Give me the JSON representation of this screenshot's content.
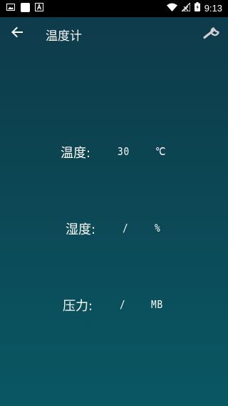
{
  "status_bar": {
    "time": "9:13",
    "left_icons": [
      "image-icon",
      "square-icon",
      "a-icon"
    ],
    "right_icons": [
      "wifi-icon",
      "signal-icon",
      "battery-icon"
    ]
  },
  "app_bar": {
    "title": "温度计",
    "back_icon": "arrow-left-icon",
    "settings_icon": "wrench-icon"
  },
  "readings": [
    {
      "label": "温度:",
      "value": "30",
      "unit": "℃"
    },
    {
      "label": "湿度:",
      "value": "/",
      "unit": "%"
    },
    {
      "label": "压力:",
      "value": "/",
      "unit": "MB"
    }
  ],
  "colors": {
    "background_top": "#0e3a4a",
    "background_bottom": "#0a5764",
    "text": "#ffffff"
  }
}
